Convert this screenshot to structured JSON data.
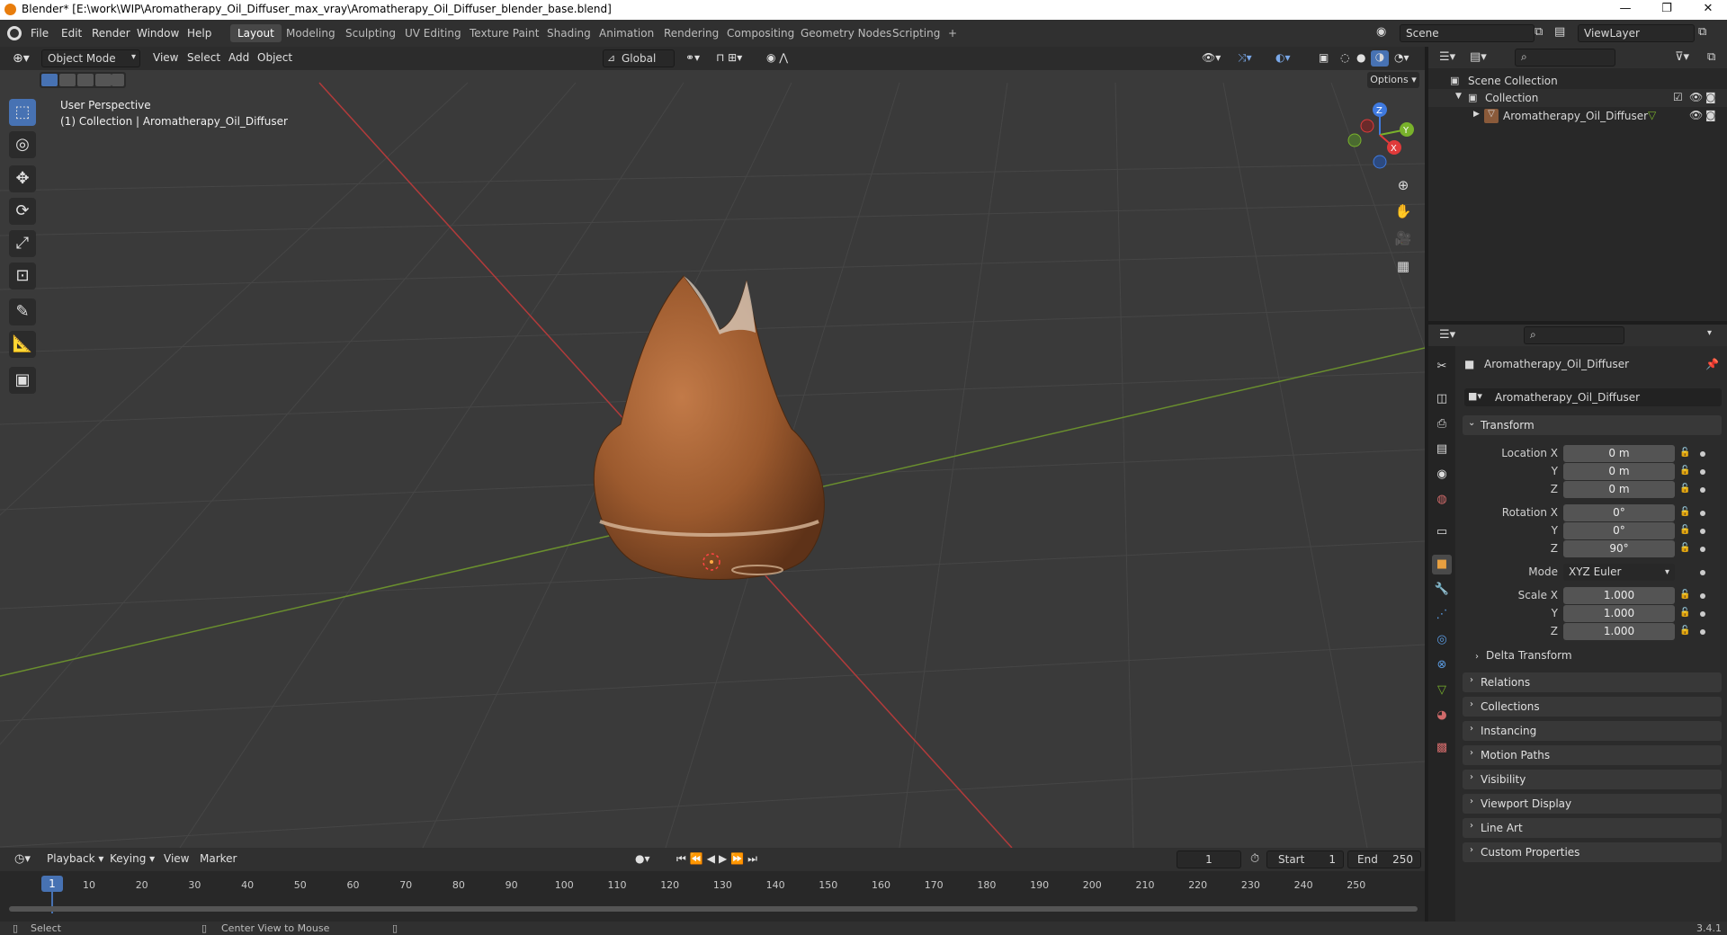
{
  "window": {
    "title": "Blender* [E:\\work\\WIP\\Aromatherapy_Oil_Diffuser_max_vray\\Aromatherapy_Oil_Diffuser_blender_base.blend]",
    "minimize": "—",
    "restore": "❐",
    "close": "✕"
  },
  "menu": [
    "File",
    "Edit",
    "Render",
    "Window",
    "Help"
  ],
  "workspaces": [
    "Layout",
    "Modeling",
    "Sculpting",
    "UV Editing",
    "Texture Paint",
    "Shading",
    "Animation",
    "Rendering",
    "Compositing",
    "Geometry Nodes",
    "Scripting",
    "+"
  ],
  "scene": {
    "name": "Scene",
    "view_layer": "ViewLayer"
  },
  "viewport": {
    "mode": "Object Mode",
    "menus": [
      "View",
      "Select",
      "Add",
      "Object"
    ],
    "orientation": "Global",
    "options_label": "Options",
    "info_line1": "User Perspective",
    "info_line2": "(1) Collection | Aromatherapy_Oil_Diffuser",
    "gizmo": {
      "z": "Z",
      "y": "Y",
      "x": "X"
    }
  },
  "tools": [
    "select-box",
    "cursor",
    "move",
    "rotate",
    "scale",
    "transform",
    "annotate",
    "measure",
    "add-cube"
  ],
  "outliner": {
    "root": "Scene Collection",
    "collection": "Collection",
    "object": "Aromatherapy_Oil_Diffuser"
  },
  "properties": {
    "object_name": "Aromatherapy_Oil_Diffuser",
    "data_name": "Aromatherapy_Oil_Diffuser",
    "transform_label": "Transform",
    "location": {
      "label": "Location X",
      "x": "0 m",
      "y": "0 m",
      "z": "0 m"
    },
    "rotation": {
      "label": "Rotation X",
      "x": "0°",
      "y": "0°",
      "z": "90°"
    },
    "mode": {
      "label": "Mode",
      "value": "XYZ Euler"
    },
    "scale": {
      "label": "Scale X",
      "x": "1.000",
      "y": "1.000",
      "z": "1.000"
    },
    "axis_y": "Y",
    "axis_z": "Z",
    "delta": "Delta Transform",
    "sections": [
      "Relations",
      "Collections",
      "Instancing",
      "Motion Paths",
      "Visibility",
      "Viewport Display",
      "Line Art",
      "Custom Properties"
    ]
  },
  "timeline": {
    "menus": [
      "Playback",
      "Keying",
      "View",
      "Marker"
    ],
    "current_frame": "1",
    "start_label": "Start",
    "start": "1",
    "end_label": "End",
    "end": "250",
    "ticks": [
      "1",
      "10",
      "20",
      "30",
      "40",
      "50",
      "60",
      "70",
      "80",
      "90",
      "100",
      "110",
      "120",
      "130",
      "140",
      "150",
      "160",
      "170",
      "180",
      "190",
      "200",
      "210",
      "220",
      "230",
      "240",
      "250"
    ]
  },
  "status": {
    "left": "Select",
    "middle": "Center View to Mouse",
    "version": "3.4.1"
  },
  "colors": {
    "accent": "#4772b3",
    "x_axis": "#e03a3a",
    "y_axis": "#79b22b",
    "z_axis": "#3f7ae0",
    "wood": "#a8653a"
  }
}
